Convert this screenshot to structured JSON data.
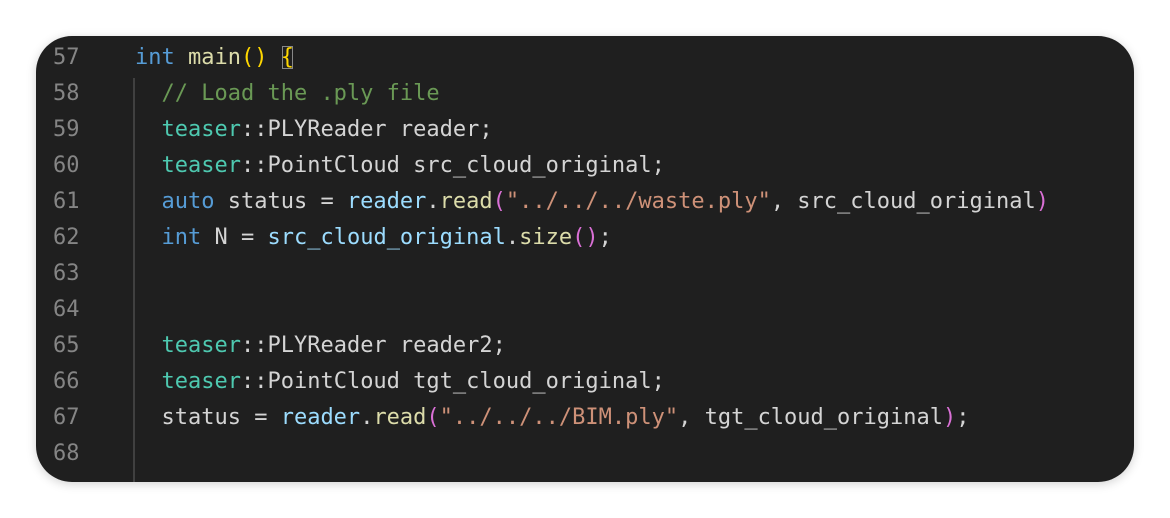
{
  "editor": {
    "language": "C++",
    "lines": [
      {
        "number": "57",
        "segments": [
          {
            "t": "int",
            "c": "kw"
          },
          {
            "t": " "
          },
          {
            "t": "main",
            "c": "fn"
          },
          {
            "t": "()",
            "c": "br1"
          },
          {
            "t": " "
          },
          {
            "t": "{",
            "c": "br1",
            "match": true
          }
        ]
      },
      {
        "number": "58",
        "segments": [
          {
            "t": "  "
          },
          {
            "t": "// Load the .ply file",
            "c": "cm"
          }
        ]
      },
      {
        "number": "59",
        "segments": [
          {
            "t": "  "
          },
          {
            "t": "teaser",
            "c": "ty"
          },
          {
            "t": "::PLYReader reader;"
          }
        ]
      },
      {
        "number": "60",
        "segments": [
          {
            "t": "  "
          },
          {
            "t": "teaser",
            "c": "ty"
          },
          {
            "t": "::PointCloud src_cloud_original;"
          }
        ]
      },
      {
        "number": "61",
        "segments": [
          {
            "t": "  "
          },
          {
            "t": "auto",
            "c": "kw"
          },
          {
            "t": " status = "
          },
          {
            "t": "reader",
            "c": "var"
          },
          {
            "t": "."
          },
          {
            "t": "read",
            "c": "fn"
          },
          {
            "t": "(",
            "c": "br2"
          },
          {
            "t": "\"../../../waste.ply\"",
            "c": "str"
          },
          {
            "t": ", src_cloud_original"
          },
          {
            "t": ")",
            "c": "br2"
          }
        ]
      },
      {
        "number": "62",
        "segments": [
          {
            "t": "  "
          },
          {
            "t": "int",
            "c": "kw"
          },
          {
            "t": " N = "
          },
          {
            "t": "src_cloud_original",
            "c": "var"
          },
          {
            "t": "."
          },
          {
            "t": "size",
            "c": "fn"
          },
          {
            "t": "()",
            "c": "br2"
          },
          {
            "t": ";"
          }
        ]
      },
      {
        "number": "63",
        "segments": []
      },
      {
        "number": "64",
        "segments": []
      },
      {
        "number": "65",
        "segments": [
          {
            "t": "  "
          },
          {
            "t": "teaser",
            "c": "ty"
          },
          {
            "t": "::PLYReader reader2;"
          }
        ]
      },
      {
        "number": "66",
        "segments": [
          {
            "t": "  "
          },
          {
            "t": "teaser",
            "c": "ty"
          },
          {
            "t": "::PointCloud tgt_cloud_original;"
          }
        ]
      },
      {
        "number": "67",
        "segments": [
          {
            "t": "  status = "
          },
          {
            "t": "reader",
            "c": "var"
          },
          {
            "t": "."
          },
          {
            "t": "read",
            "c": "fn"
          },
          {
            "t": "(",
            "c": "br2"
          },
          {
            "t": "\"../../../BIM.ply\"",
            "c": "str"
          },
          {
            "t": ", tgt_cloud_original"
          },
          {
            "t": ")",
            "c": "br2"
          },
          {
            "t": ";"
          }
        ]
      },
      {
        "number": "68",
        "segments": []
      }
    ]
  },
  "theme": {
    "background": "#1f1f1f",
    "keyword": "#569cd6",
    "function": "#dcdcaa",
    "type": "#4ec9b0",
    "variable": "#9cdcfe",
    "string": "#ce9178",
    "comment": "#6a9955",
    "bracket_level1": "#ffd700",
    "bracket_level2": "#da70d6"
  }
}
